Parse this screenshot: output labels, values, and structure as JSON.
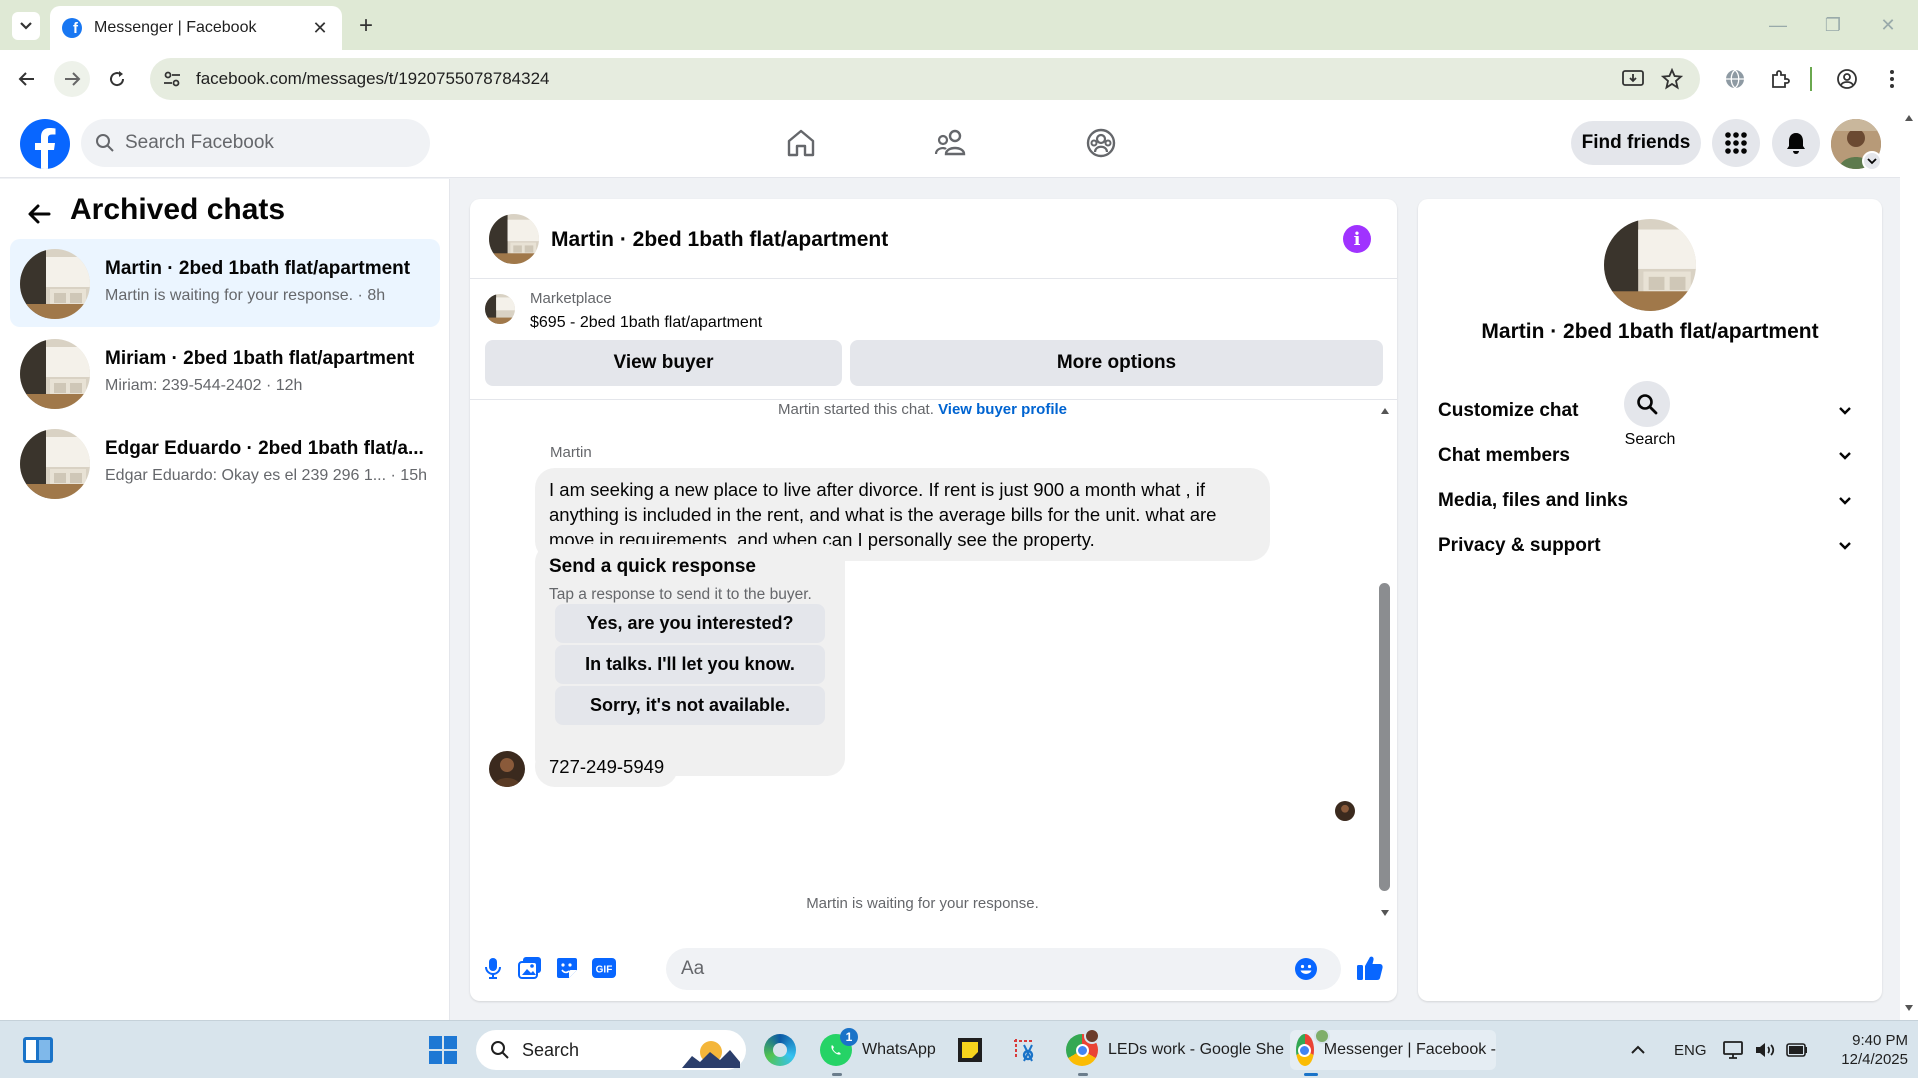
{
  "browser": {
    "tab_title": "Messenger | Facebook",
    "url": "facebook.com/messages/t/1920755078784324"
  },
  "header": {
    "search_placeholder": "Search Facebook",
    "find_friends": "Find friends"
  },
  "sidebar": {
    "title": "Archived chats",
    "chats": [
      {
        "name": "Martin · 2bed 1bath flat/apartment",
        "preview": "Martin is waiting for your response. · 8h",
        "active": true
      },
      {
        "name": "Miriam · 2bed 1bath flat/apartment",
        "preview": "Miriam: 239-544-2402 · 12h",
        "active": false
      },
      {
        "name": "Edgar Eduardo · 2bed 1bath flat/a...",
        "preview": "Edgar Eduardo: Okay es el 239 296 1... · 15h",
        "active": false
      }
    ]
  },
  "chat": {
    "title": "Martin · 2bed 1bath flat/apartment",
    "marketplace_label": "Marketplace",
    "listing": "$695 - 2bed 1bath flat/apartment",
    "view_buyer": "View buyer",
    "more_options": "More options",
    "started_text": "Martin started this chat.",
    "view_buyer_profile": "View buyer profile",
    "sender": "Martin",
    "message1": "I am seeking a new place to live after divorce. If rent is just 900 a month what , if anything is included in the rent, and what is the average bills for the unit. what are move in requirements, and when can I personally see the property.",
    "quick_title": "Send a quick response",
    "quick_sub": "Tap a response to send it to the buyer.",
    "quick_responses": [
      "Yes, are you interested?",
      "In talks. I'll let you know.",
      "Sorry, it's not available."
    ],
    "message2": "727-249-5949",
    "waiting": "Martin is waiting for your response.",
    "input_placeholder": "Aa"
  },
  "right_panel": {
    "name": "Martin · 2bed 1bath flat/apartment",
    "search_label": "Search",
    "sections": [
      "Customize chat",
      "Chat members",
      "Media, files and links",
      "Privacy & support"
    ]
  },
  "taskbar": {
    "search": "Search",
    "whatsapp": "WhatsApp",
    "whatsapp_badge": "1",
    "chrome1": "LEDs work - Google She",
    "chrome2": "Messenger | Facebook -",
    "lang": "ENG",
    "time": "9:40 PM",
    "date": "12/4/2025"
  },
  "colors": {
    "fb_blue": "#0866ff",
    "link_blue": "#0064d1",
    "info_purple": "#a033ff",
    "active_chat_bg": "#ebf5ff"
  }
}
